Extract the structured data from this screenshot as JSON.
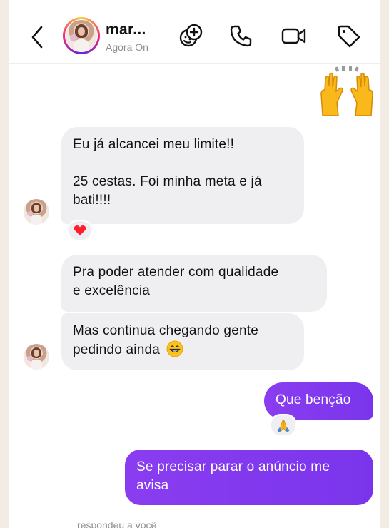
{
  "header": {
    "contact_name": "mar...",
    "status": "Agora  On",
    "icons": [
      "back-icon",
      "sticker-add-icon",
      "phone-icon",
      "video-icon",
      "tag-icon"
    ]
  },
  "messages": [
    {
      "id": "m1",
      "direction": "incoming",
      "lines": [
        "Eu já alcancei meu limite!!",
        "",
        "25 cestas. Foi minha meta e já",
        "bati!!!!"
      ],
      "reaction": "heart"
    },
    {
      "id": "m2",
      "direction": "incoming",
      "lines": [
        "Pra poder atender com qualidade",
        "e excelência"
      ]
    },
    {
      "id": "m3",
      "direction": "incoming",
      "lines": [
        "Mas continua chegando gente",
        "pedindo ainda"
      ],
      "trailing_emoji": "grinning-face"
    },
    {
      "id": "m4",
      "direction": "outgoing",
      "lines": [
        "Que benção"
      ],
      "reaction": "folded-hands"
    },
    {
      "id": "m5",
      "direction": "outgoing",
      "lines": [
        "Se precisar parar o anúncio me",
        "avisa"
      ]
    }
  ],
  "top_emoji": "raising-hands",
  "footer_note": "respondeu a você",
  "colors": {
    "outgoing_bubble": "#7a35ec",
    "incoming_bubble": "#efeff2",
    "background": "#f2ece4"
  }
}
